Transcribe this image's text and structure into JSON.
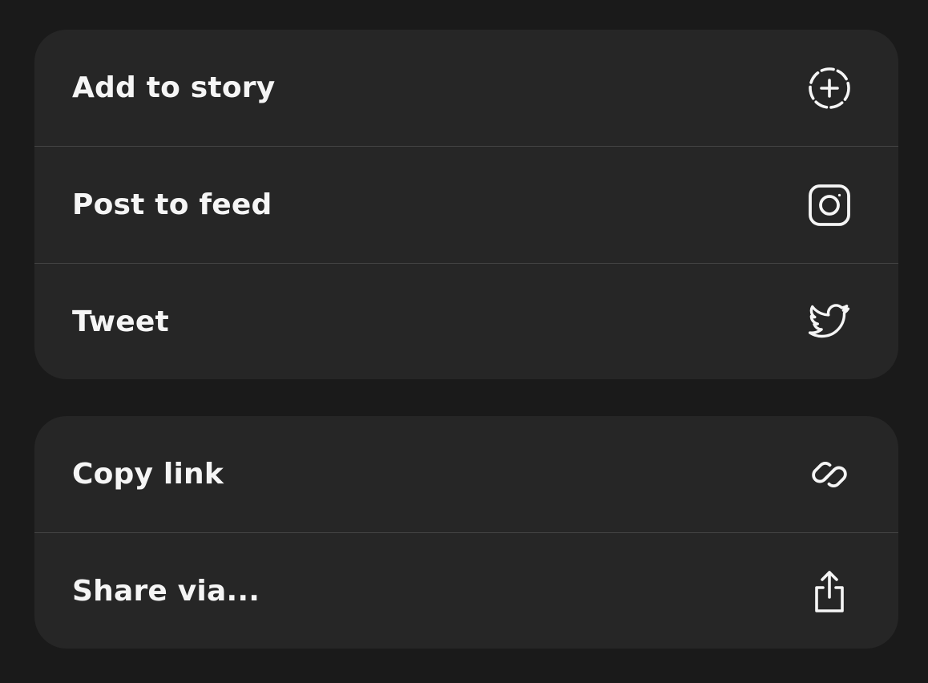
{
  "colors": {
    "background": "#1a1a1a",
    "panel": "#262626",
    "divider": "#444444",
    "text": "#f5f5f5"
  },
  "share_sheet": {
    "primary_actions": [
      {
        "label": "Add to story",
        "icon": "add-story-icon"
      },
      {
        "label": "Post to feed",
        "icon": "instagram-icon"
      },
      {
        "label": "Tweet",
        "icon": "twitter-icon"
      }
    ],
    "secondary_actions": [
      {
        "label": "Copy link",
        "icon": "link-icon"
      },
      {
        "label": "Share via...",
        "icon": "share-icon"
      }
    ]
  }
}
